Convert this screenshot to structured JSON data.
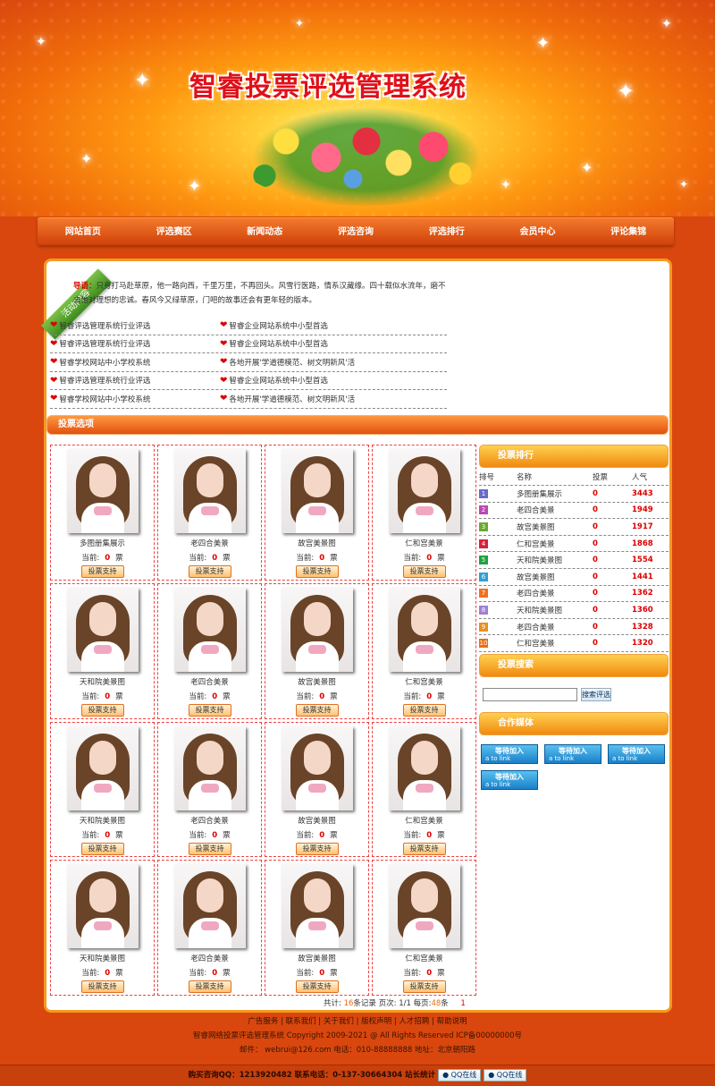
{
  "site": {
    "title": "智睿投票评选管理系统"
  },
  "nav": [
    "网站首页",
    "评选赛区",
    "新闻动态",
    "评选咨询",
    "评选排行",
    "会员中心",
    "评论集锦"
  ],
  "activity": {
    "ribbon": "活动内容",
    "intro_label": "导语：",
    "intro_text": "只身打马赴草原，他一路向西，千里万里，不再回头。风雪行医路，情系汉藏缘。四十载似水流年，磨不去他对理想的忠诚。春风今又绿草原，门吧的故事还会有更年轻的版本。",
    "news": [
      [
        "智睿评选管理系统行业评选",
        "智睿企业网站系统中小型首选"
      ],
      [
        "智睿评选管理系统行业评选",
        "智睿企业网站系统中小型首选"
      ],
      [
        "智睿学校网站中小学校系统",
        "各地开展'学道德模范、树文明新风'活"
      ],
      [
        "智睿评选管理系统行业评选",
        "智睿企业网站系统中小型首选"
      ],
      [
        "智睿学校网站中小学校系统",
        "各地开展'学道德模范、树文明新风'活"
      ]
    ]
  },
  "vote": {
    "section_title": "投票选项",
    "current_label": "当前:",
    "unit": "票",
    "button": "投票支持",
    "items": [
      {
        "name": "多图册集展示",
        "votes": "0"
      },
      {
        "name": "老四合美景",
        "votes": "0"
      },
      {
        "name": "故宫美景图",
        "votes": "0"
      },
      {
        "name": "仁和宫美景",
        "votes": "0"
      },
      {
        "name": "天和院美景图",
        "votes": "0"
      },
      {
        "name": "老四合美景",
        "votes": "0"
      },
      {
        "name": "故宫美景图",
        "votes": "0"
      },
      {
        "name": "仁和宫美景",
        "votes": "0"
      },
      {
        "name": "天和院美景图",
        "votes": "0"
      },
      {
        "name": "老四合美景",
        "votes": "0"
      },
      {
        "name": "故宫美景图",
        "votes": "0"
      },
      {
        "name": "仁和宫美景",
        "votes": "0"
      },
      {
        "name": "天和院美景图",
        "votes": "0"
      },
      {
        "name": "老四合美景",
        "votes": "0"
      },
      {
        "name": "故宫美景图",
        "votes": "0"
      },
      {
        "name": "仁和宫美景",
        "votes": "0"
      }
    ],
    "pager": {
      "total_label": "共计:",
      "total": "16",
      "records_label": "条记录 页次:",
      "pages": "1/1",
      "per_label": "每页:",
      "per": "48",
      "per_unit": "条",
      "page_link": "1"
    }
  },
  "ranking": {
    "title": "投票排行",
    "headers": [
      "排号",
      "名称",
      "投票",
      "人气"
    ],
    "rows": [
      {
        "no": "1",
        "color": "#6a6ac8",
        "name": "多图册集展示",
        "votes": "0",
        "pop": "3443"
      },
      {
        "no": "2",
        "color": "#b84ab0",
        "name": "老四合美景",
        "votes": "0",
        "pop": "1949"
      },
      {
        "no": "3",
        "color": "#6aa830",
        "name": "故宫美景图",
        "votes": "0",
        "pop": "1917"
      },
      {
        "no": "4",
        "color": "#d82040",
        "name": "仁和宫美景",
        "votes": "0",
        "pop": "1868"
      },
      {
        "no": "5",
        "color": "#20a040",
        "name": "天和院美景图",
        "votes": "0",
        "pop": "1554"
      },
      {
        "no": "6",
        "color": "#30a0d0",
        "name": "故宫美景图",
        "votes": "0",
        "pop": "1441"
      },
      {
        "no": "7",
        "color": "#f07020",
        "name": "老四合美景",
        "votes": "0",
        "pop": "1362"
      },
      {
        "no": "8",
        "color": "#a080d0",
        "name": "天和院美景图",
        "votes": "0",
        "pop": "1360"
      },
      {
        "no": "9",
        "color": "#e89020",
        "name": "老四合美景",
        "votes": "0",
        "pop": "1328"
      },
      {
        "no": "10",
        "color": "#e87010",
        "name": "仁和宫美景",
        "votes": "0",
        "pop": "1320"
      }
    ]
  },
  "search": {
    "title": "投票搜索",
    "placeholder": "",
    "button": "搜索评选"
  },
  "partners": {
    "title": "合作媒体",
    "link_text": "等待加入",
    "link_sub": "a to link",
    "count": 4
  },
  "footer": {
    "links": "广告服务 | 联系我们 | 关于我们 | 版权声明 | 人才招聘 | 帮助说明",
    "copyright": "智睿网络投票评选管理系统 Copyright 2009-2021 @ All Rights Reserved ICP备00000000号",
    "contact": "邮件： webrui@126.com 电话：010-88888888    地址：北京朝阳路",
    "hotline": "购买咨询QQ：1213920482  联系电话：0-137-30664304  站长统计",
    "qq_label": "QQ在线"
  },
  "colors": {
    "accent": "#d9470e",
    "highlight": "#f49a20",
    "alert": "#dd0000"
  }
}
